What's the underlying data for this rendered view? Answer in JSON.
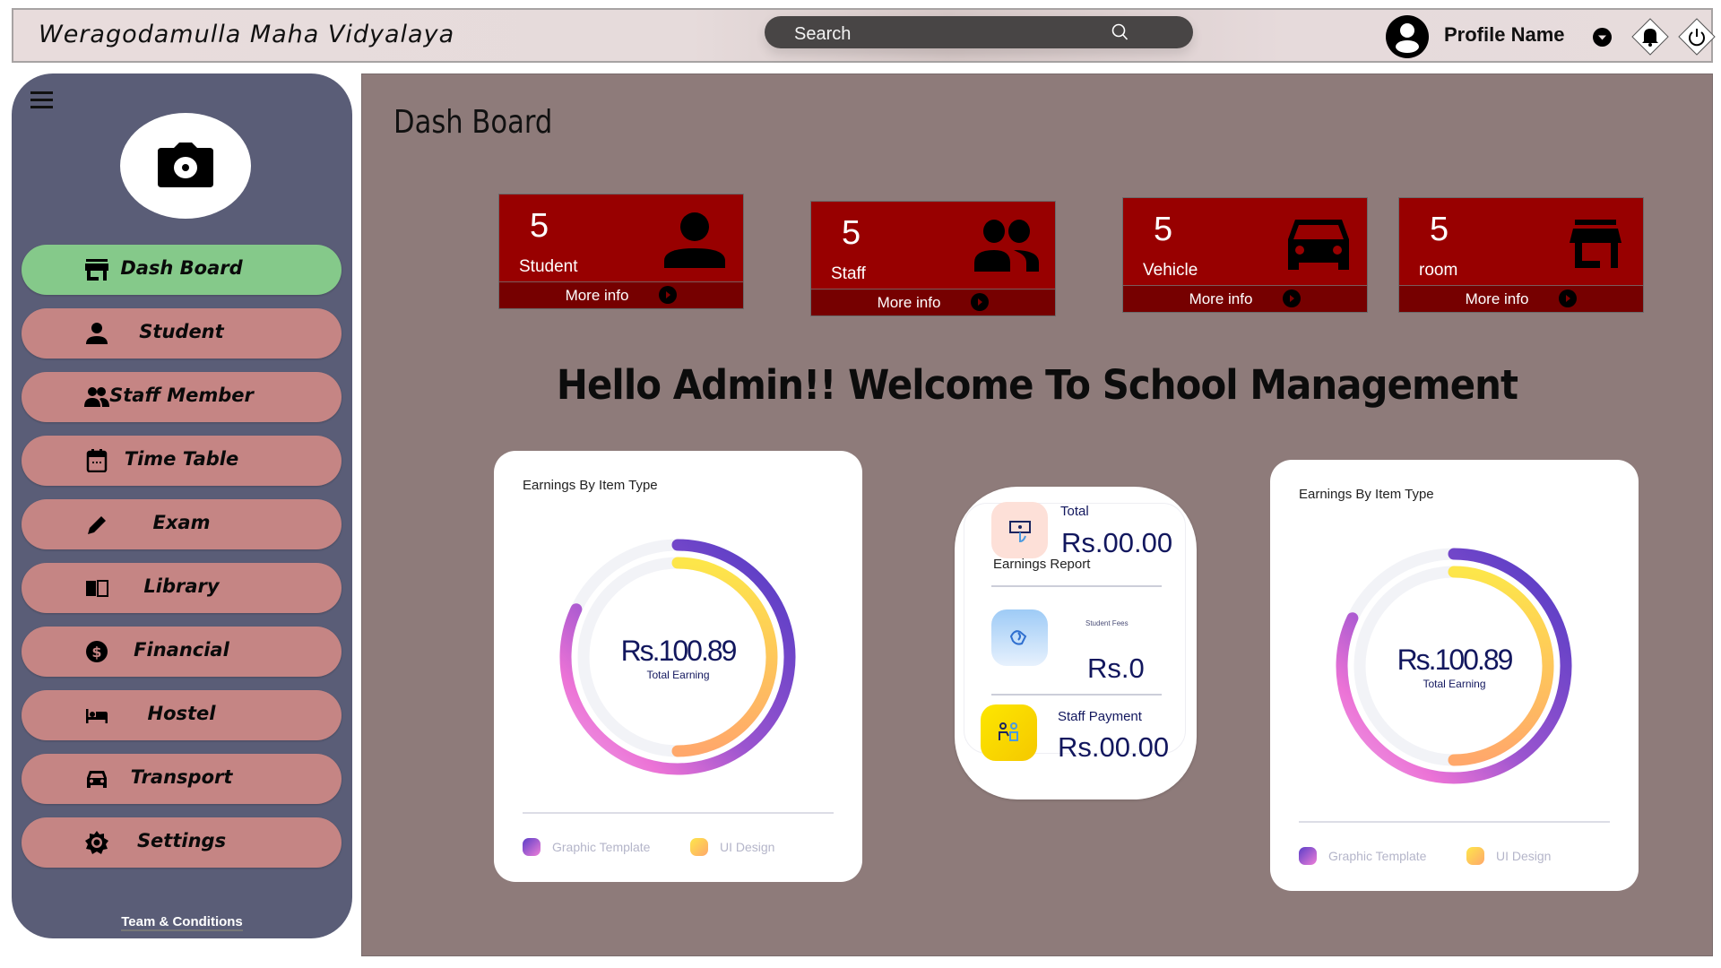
{
  "header": {
    "app_title": "Weragodamulla Maha Vidyalaya",
    "search_placeholder": "Search",
    "profile_name": "Profile Name",
    "icons": [
      "search-icon",
      "profile-avatar-icon",
      "chevron-down-icon",
      "bell-icon",
      "power-icon"
    ]
  },
  "sidebar": {
    "menu_icon": "hamburger-icon",
    "photo_icon": "camera-icon",
    "items": [
      {
        "label": "Dash Board",
        "icon": "store-icon",
        "active": true
      },
      {
        "label": "Student",
        "icon": "person-icon",
        "active": false
      },
      {
        "label": "Staff Member",
        "icon": "people-icon",
        "active": false
      },
      {
        "label": "Time Table",
        "icon": "calendar-icon",
        "active": false
      },
      {
        "label": "Exam",
        "icon": "pencil-icon",
        "active": false
      },
      {
        "label": "Library",
        "icon": "book-icon",
        "active": false
      },
      {
        "label": "Financial",
        "icon": "dollar-icon",
        "active": false
      },
      {
        "label": "Hostel",
        "icon": "bed-icon",
        "active": false
      },
      {
        "label": "Transport",
        "icon": "car-icon",
        "active": false
      },
      {
        "label": "Settings",
        "icon": "gear-icon",
        "active": false
      }
    ],
    "footer_link": "Team & Conditions"
  },
  "main": {
    "page_title": "Dash Board",
    "stats": [
      {
        "value": "5",
        "label": "Student",
        "icon": "person-icon",
        "more": "More info"
      },
      {
        "value": "5",
        "label": "Staff",
        "icon": "people-icon",
        "more": "More info"
      },
      {
        "value": "5",
        "label": "Vehicle",
        "icon": "car-icon",
        "more": "More info"
      },
      {
        "value": "5",
        "label": "room",
        "icon": "store-icon",
        "more": "More info"
      }
    ],
    "welcome": "Hello Admin!! Welcome To School Management",
    "earnings_report": {
      "total_label": "Total",
      "total_value": "Rs.00.00",
      "title": "Earnings Report",
      "fees_label": "Student Fees",
      "fees_value": "Rs.0",
      "staff_label": "Staff Payment",
      "staff_value": "Rs.00.00"
    }
  },
  "colors": {
    "stat_card": "#980000",
    "nav_active": "#85c98a",
    "nav_item": "#c58584",
    "sidebar": "#5a5d77",
    "main_bg": "#8e7b7a"
  },
  "chart_data": [
    {
      "type": "pie",
      "title": "Earnings By Item Type",
      "center_value": "Rs.100.89",
      "center_label": "Total Earning",
      "series": [
        {
          "name": "Graphic Template",
          "fraction": 0.82
        },
        {
          "name": "UI Design",
          "fraction": 0.5
        }
      ],
      "legend": [
        "Graphic Template",
        "UI Design"
      ],
      "legend_position": "bottom"
    },
    {
      "type": "pie",
      "title": "Earnings By Item Type",
      "center_value": "Rs.100.89",
      "center_label": "Total Earning",
      "series": [
        {
          "name": "Graphic Template",
          "fraction": 0.82
        },
        {
          "name": "UI Design",
          "fraction": 0.5
        }
      ],
      "legend": [
        "Graphic Template",
        "UI Design"
      ],
      "legend_position": "bottom"
    }
  ]
}
